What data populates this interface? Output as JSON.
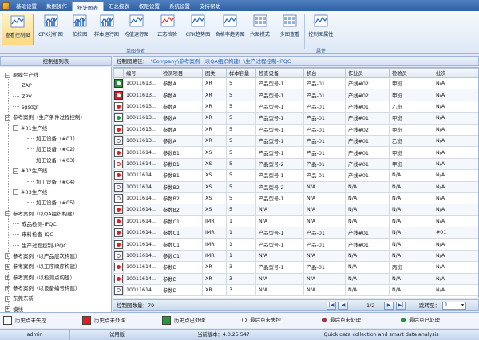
{
  "menu": {
    "items": [
      "基础设置",
      "数据操作",
      "统计图表",
      "汇总报表",
      "权限设置",
      "系统设置",
      "支持帮助"
    ],
    "active_index": 2
  },
  "ribbon": {
    "chart_buttons": [
      {
        "label": "查看控制图",
        "icon": "control-chart-icon"
      },
      {
        "label": "CPK分析图",
        "icon": "cpk-chart-icon"
      },
      {
        "label": "柏拉图",
        "icon": "pareto-chart-icon"
      },
      {
        "label": "样本运行图",
        "icon": "sample-run-chart-icon"
      },
      {
        "label": "均值运行图",
        "icon": "mean-run-chart-icon"
      },
      {
        "label": "正态检验",
        "icon": "normality-test-icon"
      },
      {
        "label": "CPK趋势图",
        "icon": "cpk-trend-icon"
      },
      {
        "label": "合格率趋势图",
        "icon": "pass-rate-trend-icon"
      },
      {
        "label": "六图模式",
        "icon": "six-chart-mode-icon"
      }
    ],
    "multi_button": "多图查看",
    "property_button": "控制图属性",
    "group_single": "单图查看",
    "group_property": "属性"
  },
  "left_panel": {
    "header": "控制组列表"
  },
  "tree": [
    {
      "label": "原膜生产线",
      "level": 0,
      "toggle": "−"
    },
    {
      "label": "ZAP",
      "level": 1
    },
    {
      "label": "ZPV",
      "level": 1
    },
    {
      "label": "sgsdgf",
      "level": 1
    },
    {
      "label": "参考案例（生产条件过程控制）",
      "level": 0,
      "toggle": "−"
    },
    {
      "label": "#01生产线",
      "level": 1,
      "toggle": "−"
    },
    {
      "label": "加工设备（#01）",
      "level": 2
    },
    {
      "label": "加工设备（#02）",
      "level": 2
    },
    {
      "label": "加工设备（#03）",
      "level": 2
    },
    {
      "label": "#02生产线",
      "level": 1,
      "toggle": "−"
    },
    {
      "label": "加工设备（#04）",
      "level": 2
    },
    {
      "label": "#03生产线",
      "level": 1,
      "toggle": "−"
    },
    {
      "label": "加工设备（#05）",
      "level": 2
    },
    {
      "label": "参考案例（以QA组织构建）",
      "level": 0,
      "toggle": "−"
    },
    {
      "label": "成品检测-IPQC",
      "level": 1
    },
    {
      "label": "来料检查-IQC",
      "level": 1
    },
    {
      "label": "生产过程控制-IPQC",
      "level": 1
    },
    {
      "label": "参考案例（以产品层次构建）",
      "level": 0,
      "toggle": "+"
    },
    {
      "label": "参考案例（以工序顺序构建）",
      "level": 0,
      "toggle": "+"
    },
    {
      "label": "参考案例（以检测点构建）",
      "level": 0,
      "toggle": "+"
    },
    {
      "label": "参考案例（以设备编号构建）",
      "level": 0,
      "toggle": "+"
    },
    {
      "label": "东莞东新",
      "level": 0,
      "toggle": "+"
    },
    {
      "label": "模线",
      "level": 0,
      "toggle": "+"
    }
  ],
  "pathbar": {
    "label": "控制图路径：",
    "path": "\\Company\\参考案例（以QA组织构建）\\生产过程控制-IPQC"
  },
  "grid": {
    "columns": [
      "编号",
      "检测项目",
      "图类",
      "样本容量",
      "检查设备",
      "机台",
      "作业员",
      "检验员",
      "批次"
    ],
    "rows": [
      {
        "status": "green",
        "sel": true,
        "cells": [
          "10011613...",
          "参数A",
          "XR",
          "5",
          "产品型号-1",
          "产品-01",
          "产线#02",
          "甲班",
          "N/A"
        ]
      },
      {
        "status": "red",
        "sel": true,
        "cells": [
          "10011613...",
          "参数A",
          "XR",
          "5",
          "产品型号-1",
          "产品-01",
          "产线#02",
          "甲班",
          "N/A"
        ]
      },
      {
        "status": "red",
        "cells": [
          "10011613...",
          "参数A",
          "XR",
          "5",
          "产品型号-1",
          "产品-01",
          "产线#01",
          "乙班",
          "N/A"
        ]
      },
      {
        "status": "green",
        "cells": [
          "10011613...",
          "参数A",
          "XR",
          "5",
          "产品型号-1",
          "产品-01",
          "产线#01",
          "甲班",
          "N/A"
        ]
      },
      {
        "status": "red",
        "cells": [
          "10011613...",
          "参数A",
          "XR",
          "5",
          "产品型号-1",
          "产品-01",
          "产线#02",
          "甲班",
          "N/A"
        ]
      },
      {
        "status": "white",
        "cells": [
          "10011613...",
          "参数A",
          "XR",
          "5",
          "产品型号-1",
          "产品-01",
          "产线#01",
          "乙班",
          "N/A"
        ]
      },
      {
        "status": "red",
        "cells": [
          "10011614...",
          "参数B1",
          "XS",
          "5",
          "产品型号-1",
          "产品-01",
          "产线#01",
          "甲班",
          "N/A"
        ]
      },
      {
        "status": "ring",
        "cells": [
          "10011614...",
          "参数B1",
          "XS",
          "5",
          "产品型号-2",
          "产品-01",
          "产线#01",
          "甲班",
          "N/A"
        ]
      },
      {
        "status": "red",
        "cells": [
          "10011614...",
          "参数B1",
          "XS",
          "5",
          "产品型号-1",
          "产品-01",
          "产线#01",
          "N/A",
          "N/A"
        ]
      },
      {
        "status": "white",
        "cells": [
          "10011614...",
          "参数B2",
          "XS",
          "5",
          "产品型号-2",
          "N/A",
          "N/A",
          "N/A",
          "N/A"
        ]
      },
      {
        "status": "white",
        "cells": [
          "10011614...",
          "参数B2",
          "XS",
          "5",
          "产品型号-1",
          "N/A",
          "N/A",
          "N/A",
          "N/A"
        ]
      },
      {
        "status": "red",
        "cells": [
          "10011614...",
          "参数B2",
          "XS",
          "5",
          "N/A",
          "N/A",
          "N/A",
          "N/A",
          "N/A"
        ]
      },
      {
        "status": "red",
        "cells": [
          "10011614...",
          "参数C1",
          "IMR",
          "1",
          "N/A",
          "N/A",
          "N/A",
          "N/A",
          "N/A"
        ]
      },
      {
        "status": "red",
        "cells": [
          "10011614...",
          "参数C1",
          "IMR",
          "1",
          "产品型号-1",
          "产品-01",
          "产线#01",
          "N/A",
          "#01"
        ]
      },
      {
        "status": "red",
        "cells": [
          "10011614...",
          "参数C1",
          "IMR",
          "1",
          "产品型号-1",
          "产品-01",
          "产线#01",
          "N/A",
          "N/A"
        ]
      },
      {
        "status": "white",
        "cells": [
          "10011614...",
          "参数C1",
          "IMR",
          "1",
          "N/A",
          "N/A",
          "N/A",
          "N/A",
          "N/A"
        ]
      },
      {
        "status": "red",
        "cells": [
          "10011614...",
          "参数D",
          "XR",
          "3",
          "产品型号-1",
          "产品-01",
          "N/A",
          "丙班",
          "N/A"
        ]
      },
      {
        "status": "red",
        "cells": [
          "10011614...",
          "参数D",
          "XR",
          "3",
          "N/A",
          "N/A",
          "N/A",
          "N/A",
          "N/A"
        ]
      },
      {
        "status": "white",
        "cells": [
          "10011614...",
          "参数D",
          "XR",
          "3",
          "N/A",
          "N/A",
          "N/A",
          "N/A",
          "N/A"
        ]
      }
    ]
  },
  "pager": {
    "count": "控制图数量：79",
    "page": "1/2",
    "jump_label": "跳转至：",
    "jump_value": "1"
  },
  "legend": [
    {
      "kind": "sq",
      "color": "#ffffff",
      "label": "历史点未失控"
    },
    {
      "kind": "sq",
      "color": "#e8191f",
      "label": "历史点未处理"
    },
    {
      "kind": "sq",
      "color": "#1f9b3a",
      "label": "历史点已处理"
    },
    {
      "kind": "dot",
      "color": "#ffffff",
      "label": "最后点未失控"
    },
    {
      "kind": "dot",
      "color": "#e8191f",
      "label": "最后点未处理"
    },
    {
      "kind": "dot",
      "color": "#1f9b3a",
      "label": "最后点已处理"
    }
  ],
  "status": {
    "user": "admin",
    "edition": "试用版",
    "version": "当前版本：4.0.25.547",
    "slogan": "Quick data collection and smart data analysis"
  },
  "colors": {
    "red": "#e8191f",
    "green": "#1f9b3a",
    "accent": "#2d5fa3"
  }
}
